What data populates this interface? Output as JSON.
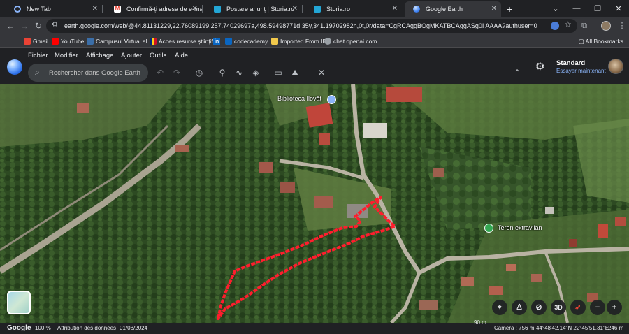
{
  "browser": {
    "tabs": [
      {
        "title": "New Tab",
        "color": "#8ab4f8"
      },
      {
        "title": "Confirmă-ți adresa de e-mail - ",
        "color": "#ea4335"
      },
      {
        "title": "Postare anunț | Storia.ro",
        "color": "#23a6d5"
      },
      {
        "title": "Storia.ro",
        "color": "#23a6d5"
      },
      {
        "title": "Google Earth",
        "color": "#4285f4"
      }
    ],
    "url": "earth.google.com/web/@44.81131229,22.76089199,257.74029697a,498.59498771d,35y,341.19702982h,0t,0r/data=CgRCAggBOgMKATBCAggASg0I                AAAA?authuser=0",
    "bookmarks": [
      "Gmail",
      "YouTube",
      "Campusul Virtual al...",
      "Acces resurse științif...",
      "codecademy",
      "Imported From IE",
      "chat.openai.com"
    ],
    "bookmark_colors": [
      "#ea4335",
      "#ff0000",
      "#3b6ea8",
      "#e8b64a",
      "#0a66c2",
      "#f2c94c",
      "#9aa0a6"
    ],
    "all_bookmarks": "All Bookmarks"
  },
  "earth": {
    "menu": [
      "Fichier",
      "Modifier",
      "Affichage",
      "Ajouter",
      "Outils",
      "Aide"
    ],
    "search_placeholder": "Rechercher dans Google Earth",
    "account": {
      "style": "Standard",
      "try_now": "Essayer maintenant"
    },
    "icons": [
      "undo-icon",
      "redo-icon",
      "history-icon",
      "placemark-icon",
      "path-icon",
      "layers-icon",
      "ruler-icon",
      "image-overlay-icon",
      "measure-icon",
      "collapse-icon"
    ]
  },
  "map": {
    "places": [
      {
        "label": "Biblioteca Ilovăț",
        "kind": "library"
      },
      {
        "label": "Teren extravilan",
        "kind": "land"
      }
    ],
    "controls": [
      "3D"
    ]
  },
  "status": {
    "brand": "Google",
    "zoom": "100 %",
    "attribution": "Attribution des données",
    "date": "01/08/2024",
    "scale": "90 m",
    "camera": "Caméra : 756 m",
    "coords": "44°48'42.14\"N 22°45'51.31\"E",
    "elevation": "246 m"
  }
}
